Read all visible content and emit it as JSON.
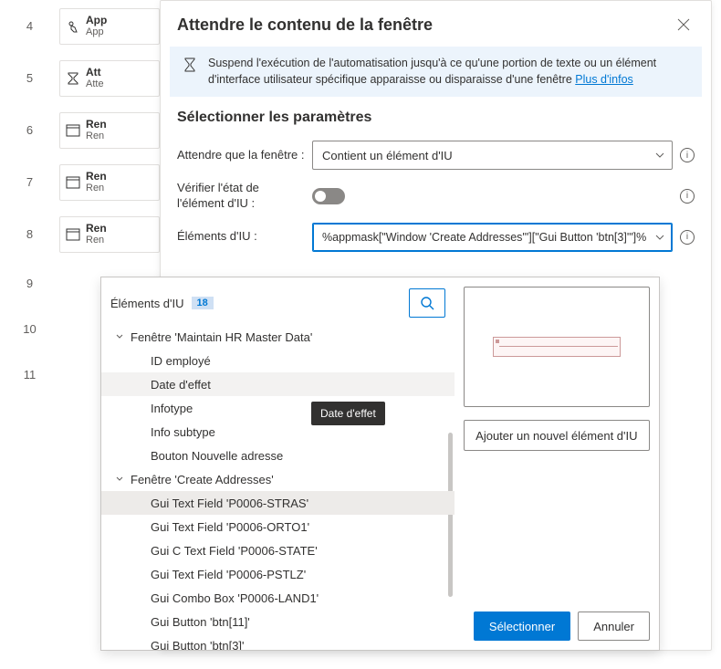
{
  "bg_rows": [
    {
      "num": "4",
      "t1": "App",
      "t2": "App",
      "icon": "touch"
    },
    {
      "num": "5",
      "t1": "Att",
      "t2": "Atte",
      "icon": "hourglass"
    },
    {
      "num": "6",
      "t1": "Ren",
      "t2": "Ren",
      "icon": "window"
    },
    {
      "num": "7",
      "t1": "Ren",
      "t2": "Ren",
      "icon": "window"
    },
    {
      "num": "8",
      "t1": "Ren",
      "t2": "Ren",
      "icon": "window"
    }
  ],
  "bg_stubs": [
    "9",
    "10",
    "11"
  ],
  "dialog": {
    "title": "Attendre le contenu de la fenêtre",
    "info_text": "Suspend l'exécution de l'automatisation jusqu'à ce qu'une portion de texte ou un élément d'interface utilisateur spécifique apparaisse ou disparaisse d'une fenêtre ",
    "info_link": "Plus d'infos",
    "section_title": "Sélectionner les paramètres",
    "param1_label": "Attendre que la fenêtre :",
    "param1_value": "Contient un élément d'IU",
    "param2_label": "Vérifier l'état de l'élément d'IU :",
    "param3_label": "Éléments d'IU :",
    "param3_value": "%appmask[\"Window 'Create Addresses'\"][\"Gui Button 'btn[3]'\"]%"
  },
  "ui_panel": {
    "title": "Éléments d'IU",
    "count": "18",
    "tree": [
      {
        "level": "parent",
        "label": "Fenêtre 'Maintain HR Master Data'",
        "expanded": true
      },
      {
        "level": "child",
        "label": "ID employé"
      },
      {
        "level": "child",
        "label": "Date d'effet",
        "hover": true,
        "tooltip": "Date d'effet"
      },
      {
        "level": "child",
        "label": "Infotype"
      },
      {
        "level": "child",
        "label": "Info subtype"
      },
      {
        "level": "child",
        "label": "Bouton Nouvelle adresse"
      },
      {
        "level": "parent",
        "label": "Fenêtre 'Create Addresses'",
        "expanded": true
      },
      {
        "level": "gchild",
        "label": "Gui Text Field 'P0006-STRAS'",
        "selected": true
      },
      {
        "level": "gchild",
        "label": "Gui Text Field 'P0006-ORTO1'"
      },
      {
        "level": "gchild",
        "label": "Gui C Text Field 'P0006-STATE'"
      },
      {
        "level": "gchild",
        "label": "Gui Text Field 'P0006-PSTLZ'"
      },
      {
        "level": "gchild",
        "label": "Gui Combo Box 'P0006-LAND1'"
      },
      {
        "level": "gchild",
        "label": "Gui Button 'btn[11]'"
      },
      {
        "level": "gchild",
        "label": "Gui Button 'btn[3]'"
      }
    ],
    "add_button": "Ajouter un nouvel élément d'IU",
    "select_button": "Sélectionner",
    "cancel_button": "Annuler"
  }
}
